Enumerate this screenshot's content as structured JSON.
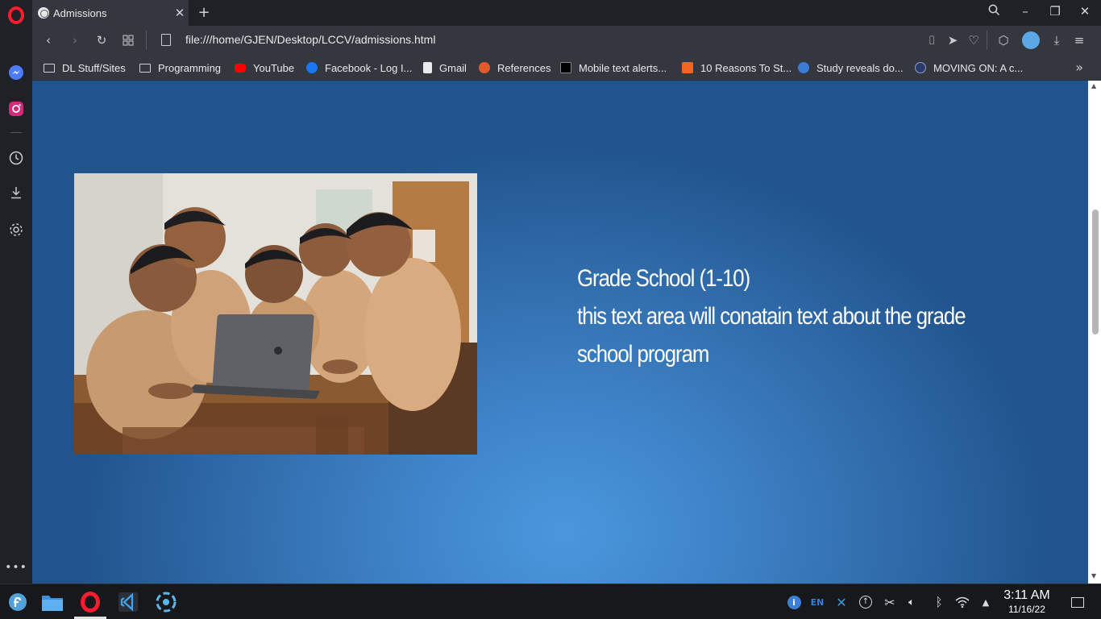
{
  "browser": {
    "tab": {
      "title": "Admissions",
      "favicon": "globe-icon"
    },
    "url": "file:///home/GJEN/Desktop/LCCV/admissions.html",
    "bookmarks": [
      {
        "label": "DL Stuff/Sites",
        "icon": "folder-icon"
      },
      {
        "label": "Programming",
        "icon": "folder-icon"
      },
      {
        "label": "YouTube",
        "icon": "youtube-icon",
        "color": "#ff0000"
      },
      {
        "label": "Facebook - Log I...",
        "icon": "facebook-icon",
        "color": "#1877f2"
      },
      {
        "label": "Gmail",
        "icon": "document-icon"
      },
      {
        "label": "References",
        "icon": "graduation-cap-icon",
        "color": "#e25a2b"
      },
      {
        "label": "Mobile text alerts...",
        "icon": "w-icon",
        "color": "#111111"
      },
      {
        "label": "10 Reasons To St...",
        "icon": "checkbox-icon",
        "color": "#f26522"
      },
      {
        "label": "Study reveals do...",
        "icon": "inq-icon",
        "color": "#3a7bd5"
      },
      {
        "label": "MOVING ON: A c...",
        "icon": "seal-icon",
        "color": "#2a3a6a"
      }
    ]
  },
  "page": {
    "heading": "Grade School (1-10)",
    "body": "this text area will conatain text about the grade school program",
    "image_alt": "children gathered around a laptop in a classroom",
    "background_color": "#2f6aa9"
  },
  "taskbar": {
    "time": "3:11 AM",
    "date": "11/16/22",
    "keyboard_layout": "EN"
  }
}
